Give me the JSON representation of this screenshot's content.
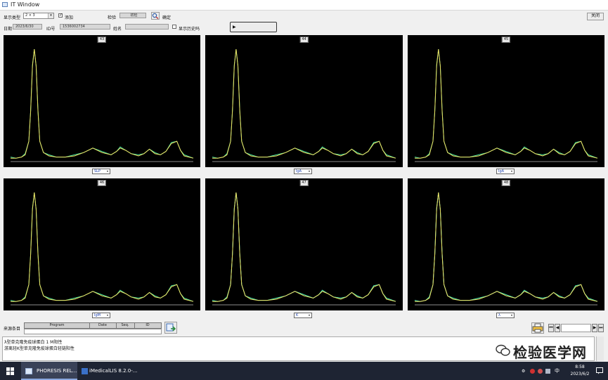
{
  "window": {
    "title": "IT Window"
  },
  "toolbar": {
    "display_type_label": "显示类型",
    "display_type_value": "2 × 3",
    "add_label": "添加",
    "add_checked": true,
    "search_label": "检验",
    "search_value": "初检",
    "confirm_label": "确定",
    "close_label": "关闭",
    "date_label": "日期",
    "date_value": "2023/6/30",
    "id_label": "ID号",
    "id_value": "1536002734",
    "name_label": "姓名",
    "name_value": "",
    "show_history_label": "显示历史吗",
    "play_label": "▶"
  },
  "panels": [
    {
      "number": "43",
      "select": "SLP"
    },
    {
      "number": "44",
      "select": "IgA"
    },
    {
      "number": "45",
      "select": "IgA"
    },
    {
      "number": "46",
      "select": "IgM"
    },
    {
      "number": "47",
      "select": "K"
    },
    {
      "number": "48",
      "select": "λ"
    }
  ],
  "bottom": {
    "results_label": "来源条目",
    "grid_headers": [
      "Program",
      "Date",
      "Seq.",
      "ID"
    ],
    "notes": [
      "λ型单克隆免疫球蛋白 1 M阳性",
      "游离轻K型单克隆免疫球蛋白轻链阳性"
    ]
  },
  "watermark": "检验医学网",
  "taskbar": {
    "items": [
      "PHORESIS REL...",
      "iMedicalLIS 8.2.0-..."
    ],
    "time": "8:58",
    "date": "2023/6/2",
    "lang": "中"
  },
  "colors": {
    "plot_bg": "#000000",
    "trace_yellow": "#f0e060",
    "trace_green": "#48e4a0",
    "trace_blue": "#4a80ff"
  },
  "chart_data": {
    "type": "line",
    "note_series": "electrophoresis densitometry trace, one per panel",
    "x": [
      0,
      3,
      6,
      8,
      10,
      11,
      12,
      13,
      14,
      15,
      16,
      18,
      21,
      25,
      30,
      35,
      40,
      45,
      50,
      55,
      58,
      60,
      63,
      66,
      70,
      73,
      76,
      79,
      82,
      85,
      88,
      91,
      93,
      95,
      100
    ],
    "y": [
      3,
      3,
      4,
      6,
      18,
      45,
      85,
      100,
      85,
      45,
      18,
      8,
      5,
      4,
      4,
      5,
      8,
      12,
      8,
      6,
      9,
      12,
      10,
      7,
      5,
      7,
      11,
      7,
      6,
      9,
      16,
      18,
      10,
      5,
      3
    ]
  }
}
